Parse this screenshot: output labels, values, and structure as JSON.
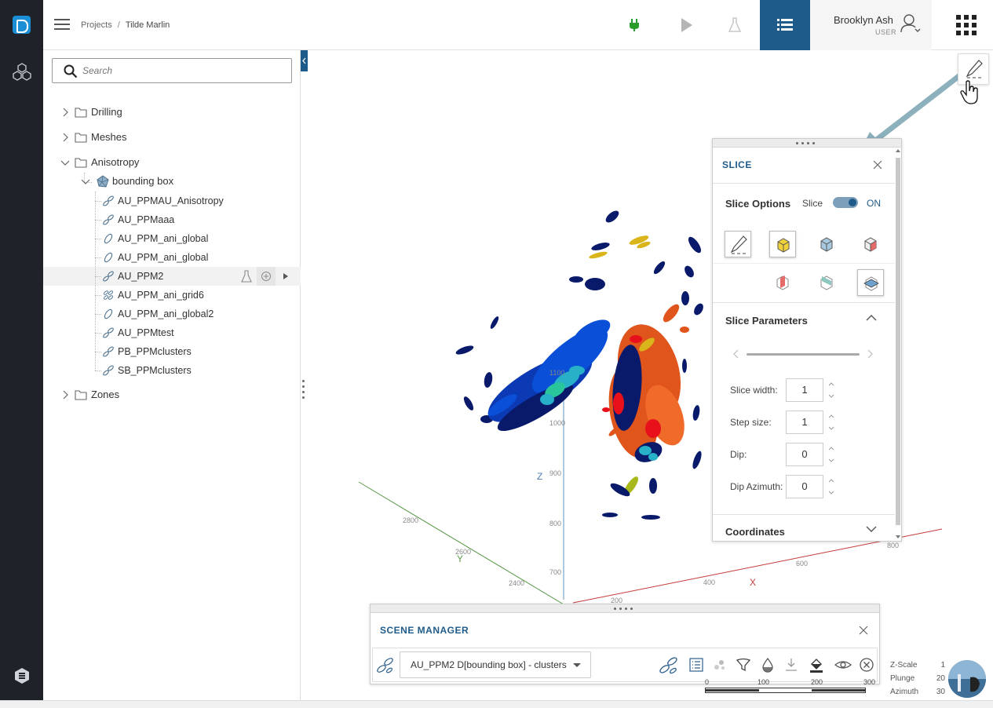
{
  "topbar": {
    "breadcrumb": [
      "Projects",
      "Tilde Marlin"
    ],
    "user_name": "Brooklyn Ash",
    "user_role": "USER"
  },
  "tree": {
    "search_placeholder": "Search",
    "folders": [
      "Drilling",
      "Meshes",
      "Anisotropy",
      "Zones"
    ],
    "bounding_box": "bounding box",
    "items": [
      "AU_PPMAU_Anisotropy",
      "AU_PPMaaa",
      "AU_PPM_ani_global",
      "AU_PPM_ani_global",
      "AU_PPM2",
      "AU_PPM_ani_grid6",
      "AU_PPM_ani_global2",
      "AU_PPMtest",
      "PB_PPMclusters",
      "SB_PPMclusters"
    ]
  },
  "slice": {
    "title": "SLICE",
    "options_title": "Slice Options",
    "slice_label": "Slice",
    "toggle_state": "ON",
    "params_title": "Slice Parameters",
    "params": [
      {
        "label": "Slice width:",
        "value": "1"
      },
      {
        "label": "Step size:",
        "value": "1"
      },
      {
        "label": "Dip:",
        "value": "0"
      },
      {
        "label": "Dip Azimuth:",
        "value": "0"
      }
    ],
    "coords_title": "Coordinates"
  },
  "scene_manager": {
    "title": "SCENE MANAGER",
    "selected_layer": "AU_PPM2 D[bounding box] - clusters"
  },
  "axes": {
    "z_label": "Z",
    "y_label": "Y",
    "x_label": "X",
    "z_ticks": [
      "1100",
      "1000",
      "900",
      "800",
      "700"
    ],
    "y_ticks": [
      "2800",
      "2600",
      "2400"
    ],
    "x_ticks": [
      "200",
      "400",
      "600",
      "800"
    ]
  },
  "scale": {
    "ticks": [
      "0",
      "100",
      "200",
      "300"
    ]
  },
  "view_stats": [
    {
      "label": "Z-Scale",
      "value": "1"
    },
    {
      "label": "Plunge",
      "value": "20"
    },
    {
      "label": "Azimuth",
      "value": "30"
    }
  ],
  "colors": {
    "brand": "#1f5b8a",
    "rail": "#1f2329",
    "run_indicator": "#2a9d2a"
  }
}
